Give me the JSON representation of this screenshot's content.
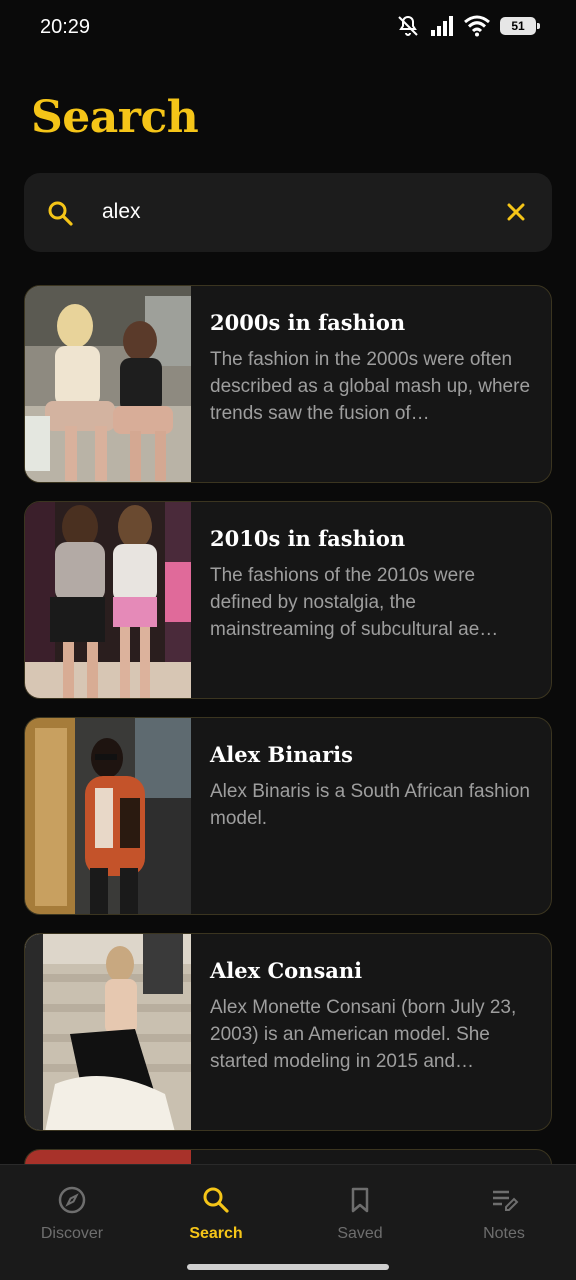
{
  "status_bar": {
    "time": "20:29",
    "battery": "51"
  },
  "page": {
    "title": "Search"
  },
  "search": {
    "value": "alex",
    "placeholder": "Search"
  },
  "results": [
    {
      "title": "2000s in fashion",
      "description": "The fashion in the 2000s were often described as a global mash up, where trends saw the fusion of…"
    },
    {
      "title": "2010s in fashion",
      "description": "The fashions of the 2010s were defined by nostalgia, the mainstreaming of subcultural ae…"
    },
    {
      "title": "Alex Binaris",
      "description": "Alex Binaris is a South African fashion model."
    },
    {
      "title": "Alex Consani",
      "description": "Alex Monette Consani (born July 23, 2003) is an American model. She started modeling in 2015 and…"
    }
  ],
  "nav": {
    "items": [
      {
        "label": "Discover",
        "icon": "compass-icon",
        "active": false
      },
      {
        "label": "Search",
        "icon": "search-icon",
        "active": true
      },
      {
        "label": "Saved",
        "icon": "bookmark-icon",
        "active": false
      },
      {
        "label": "Notes",
        "icon": "notes-icon",
        "active": false
      }
    ]
  },
  "colors": {
    "accent": "#f5c518",
    "background": "#0a0a0a",
    "card": "#161616",
    "card_border": "#3b3520",
    "muted_text": "#9e9e9e"
  }
}
